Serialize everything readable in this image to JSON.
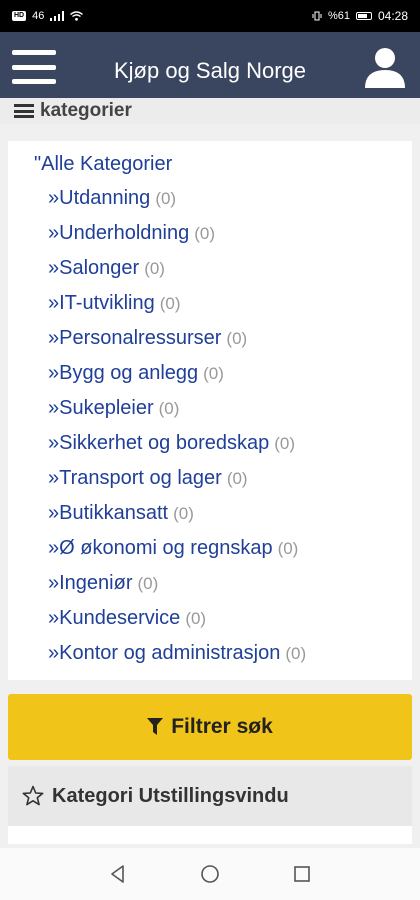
{
  "status_bar": {
    "carrier": "HD",
    "signal": "46",
    "battery_text": "%61",
    "time": "04:28"
  },
  "app_bar": {
    "title": "Kjøp og Salg Norge",
    "menu_icon": "hamburger-menu-icon",
    "profile_icon": "user-icon"
  },
  "section": {
    "icon": "bars-icon",
    "title": "kategorier"
  },
  "categories": {
    "all_label": "\"Alle Kategorier",
    "items": [
      {
        "label": "»Utdanning",
        "count": "(0)"
      },
      {
        "label": "»Underholdning",
        "count": "(0)"
      },
      {
        "label": "»Salonger",
        "count": "(0)"
      },
      {
        "label": "»IT-utvikling",
        "count": "(0)"
      },
      {
        "label": "»Personalressurser",
        "count": "(0)"
      },
      {
        "label": "»Bygg og anlegg",
        "count": "(0)"
      },
      {
        "label": "»Sukepleier",
        "count": "(0)"
      },
      {
        "label": "»Sikkerhet og boredskap",
        "count": "(0)"
      },
      {
        "label": "»Transport og lager",
        "count": "(0)"
      },
      {
        "label": "»Butikkansatt",
        "count": "(0)"
      },
      {
        "label": "»Ø økonomi og regnskap",
        "count": "(0)"
      },
      {
        "label": "»Ingeniør",
        "count": "(0)"
      },
      {
        "label": "»Kundeservice",
        "count": "(0)"
      },
      {
        "label": "»Kontor og administrasjon",
        "count": "(0)"
      }
    ]
  },
  "filter_button": {
    "label": "Filtrer søk",
    "icon": "filter-icon",
    "color": "#f0c419"
  },
  "showcase": {
    "label": "Kategori Utstillingsvindu",
    "icon": "star-icon"
  },
  "nav_bar": {
    "back_icon": "back-icon",
    "home_icon": "home-icon",
    "recents_icon": "recents-icon"
  },
  "colors": {
    "app_bar": "#3a4660",
    "link": "#1f3f99",
    "count": "#999999"
  }
}
